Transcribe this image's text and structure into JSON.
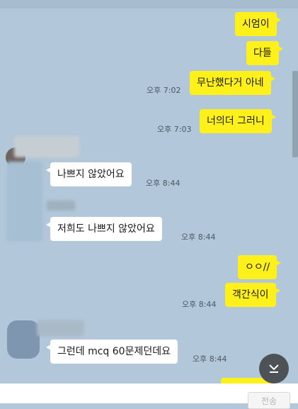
{
  "messages": [
    {
      "text": "시엄이"
    },
    {
      "text": "다들"
    },
    {
      "text": "무난했다거 아네",
      "time": "오후 7:02"
    },
    {
      "text": "너의더 그러니",
      "time": "오후 7:03"
    },
    {
      "text": "나쁘지 않았어요",
      "time": "오후 8:44"
    },
    {
      "text": "저희도 나쁘지 않았어요",
      "time": "오후 8:44"
    },
    {
      "text": "ㅇㅇ//"
    },
    {
      "text": "객간식이",
      "time": "오후 8:44"
    },
    {
      "text": "그런데 mcq 60문제던데요",
      "time": "오후 8:44"
    }
  ],
  "icons": {
    "scroll_down": "arrow-down-to-line-icon"
  },
  "input": {
    "send_label": "전송"
  },
  "colors": {
    "background": "#b2c7d9",
    "my_bubble": "#fef01b",
    "other_bubble": "#ffffff"
  }
}
